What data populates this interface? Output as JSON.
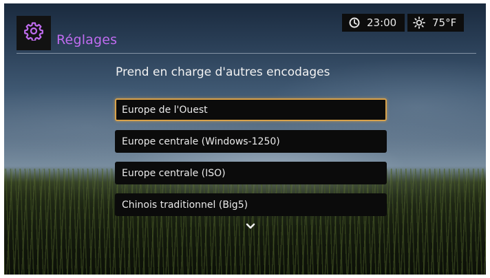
{
  "header": {
    "title": "Réglages",
    "settings_icon": "gear-icon",
    "accent_color": "#c06cf0"
  },
  "status": {
    "time": "23:00",
    "time_icon": "clock-icon",
    "temperature": "75°F",
    "weather_icon": "sun-icon"
  },
  "main": {
    "heading": "Prend en charge d'autres encodages",
    "options": [
      {
        "label": "Europe de l'Ouest",
        "selected": true
      },
      {
        "label": "Europe centrale (Windows-1250)",
        "selected": false
      },
      {
        "label": "Europe centrale (ISO)",
        "selected": false
      },
      {
        "label": "Chinois traditionnel (Big5)",
        "selected": false
      }
    ],
    "scroll_indicator_icon": "chevron-down-icon",
    "selection_color": "#d9a24a"
  }
}
